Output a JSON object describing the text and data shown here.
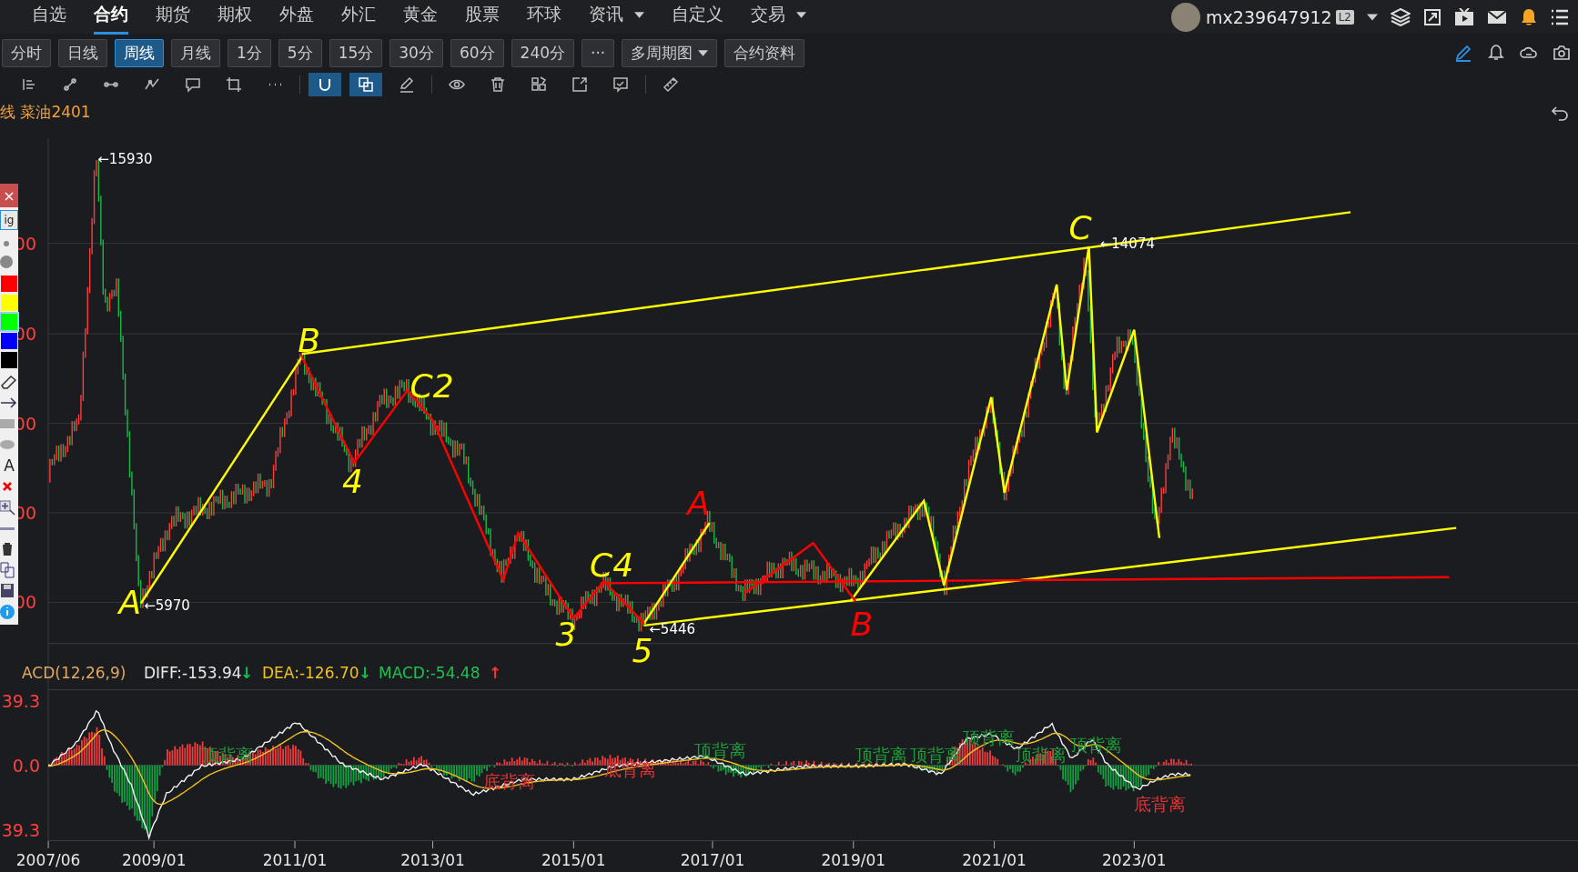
{
  "nav": {
    "items": [
      {
        "label": "自选",
        "selected": false,
        "caret": false
      },
      {
        "label": "合约",
        "selected": true,
        "caret": false
      },
      {
        "label": "期货",
        "selected": false,
        "caret": false
      },
      {
        "label": "期权",
        "selected": false,
        "caret": false
      },
      {
        "label": "外盘",
        "selected": false,
        "caret": false
      },
      {
        "label": "外汇",
        "selected": false,
        "caret": false
      },
      {
        "label": "黄金",
        "selected": false,
        "caret": false
      },
      {
        "label": "股票",
        "selected": false,
        "caret": false
      },
      {
        "label": "环球",
        "selected": false,
        "caret": false
      },
      {
        "label": "资讯",
        "selected": false,
        "caret": true
      },
      {
        "label": "自定义",
        "selected": false,
        "caret": false
      },
      {
        "label": "交易",
        "selected": false,
        "caret": true
      }
    ],
    "user": "mx239647912",
    "badge": "L2"
  },
  "periods": [
    {
      "label": "分时",
      "selected": false
    },
    {
      "label": "日线",
      "selected": false
    },
    {
      "label": "周线",
      "selected": true
    },
    {
      "label": "月线",
      "selected": false
    },
    {
      "label": "1分",
      "selected": false
    },
    {
      "label": "5分",
      "selected": false
    },
    {
      "label": "15分",
      "selected": false
    },
    {
      "label": "30分",
      "selected": false
    },
    {
      "label": "60分",
      "selected": false
    },
    {
      "label": "240分",
      "selected": false
    },
    {
      "label": "···",
      "selected": false
    }
  ],
  "period_buttons": [
    {
      "label": "多周期图",
      "caret": true
    },
    {
      "label": "合约资料",
      "caret": false
    }
  ],
  "tools": [
    {
      "kind": "align",
      "on": false
    },
    {
      "kind": "segment",
      "on": false
    },
    {
      "kind": "line",
      "on": false
    },
    {
      "kind": "wave",
      "on": false
    },
    {
      "kind": "comment",
      "on": false
    },
    {
      "kind": "crop",
      "on": false
    },
    {
      "kind": "more",
      "on": false
    },
    {
      "kind": "magnet",
      "on": true
    },
    {
      "kind": "copy",
      "on": true
    },
    {
      "kind": "pen",
      "on": false
    },
    {
      "kind": "eye",
      "on": false
    },
    {
      "kind": "trash",
      "on": false
    },
    {
      "kind": "grid",
      "on": false
    },
    {
      "kind": "export",
      "on": false
    },
    {
      "kind": "note",
      "on": false
    },
    {
      "kind": "ruler",
      "on": false
    }
  ],
  "chart_title": "线 菜油2401",
  "price_axis": [
    "00",
    "00",
    "00",
    "00",
    "00"
  ],
  "price_marks": [
    {
      "text": "←15930"
    },
    {
      "text": "←5970"
    },
    {
      "text": "←14074"
    },
    {
      "text": "←5446"
    }
  ],
  "handwriting": [
    {
      "text": "A",
      "color": "#ffff00"
    },
    {
      "text": "B",
      "color": "#ffff00"
    },
    {
      "text": "4",
      "color": "#ffff00"
    },
    {
      "text": "C2",
      "color": "#ffff00"
    },
    {
      "text": "C4",
      "color": "#ffff00"
    },
    {
      "text": "3",
      "color": "#ffff00"
    },
    {
      "text": "5",
      "color": "#ffff00"
    },
    {
      "text": "A",
      "color": "#ff0000"
    },
    {
      "text": "B",
      "color": "#ff0000"
    },
    {
      "text": "C",
      "color": "#ffff00"
    }
  ],
  "palette": {
    "close": "×",
    "button": "ig",
    "swatches": [
      {
        "color": "#ff0000",
        "selected": false
      },
      {
        "color": "#ffff00",
        "selected": false
      },
      {
        "color": "#00ff00",
        "selected": true
      },
      {
        "color": "#0000ff",
        "selected": false
      },
      {
        "color": "#000000",
        "selected": false
      }
    ],
    "letter": "A"
  },
  "macd": {
    "name": "ACD(12,26,9)",
    "values": [
      {
        "label": "DIFF:-153.94",
        "kind": "diff",
        "arrow": "↓"
      },
      {
        "label": "DEA:-126.70",
        "kind": "dea",
        "arrow": "↓"
      },
      {
        "label": "MACD:-54.48",
        "kind": "macd",
        "arrow": "↑"
      }
    ],
    "axis": [
      "39.3",
      "0.0",
      "39.3"
    ],
    "signals": [
      {
        "text": "顶背离",
        "kind": "top"
      },
      {
        "text": "底背离",
        "kind": "bottom"
      },
      {
        "text": "底背离",
        "kind": "bottom"
      },
      {
        "text": "顶背离",
        "kind": "top"
      },
      {
        "text": "顶背离",
        "kind": "top"
      },
      {
        "text": "顶背离",
        "kind": "top"
      },
      {
        "text": "顶背离",
        "kind": "top"
      },
      {
        "text": "顶背离",
        "kind": "top"
      },
      {
        "text": "顶背离",
        "kind": "top"
      },
      {
        "text": "底背离",
        "kind": "bottom"
      }
    ]
  },
  "time_axis": [
    "2007/06",
    "2009/01",
    "2011/01",
    "2013/01",
    "2015/01",
    "2017/01",
    "2019/01",
    "2021/01",
    "2023/01"
  ]
}
